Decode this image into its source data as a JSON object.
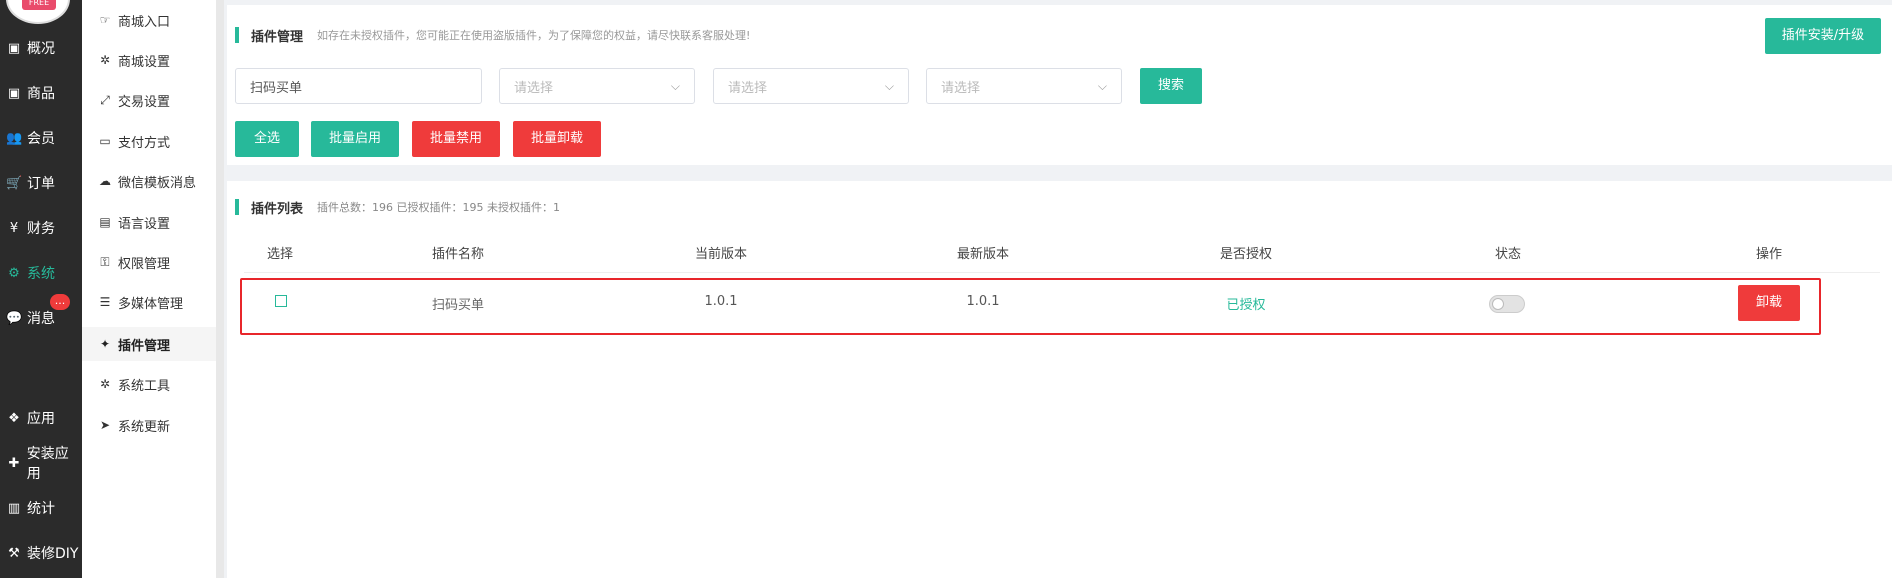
{
  "logo": {
    "badge_text": "FREE"
  },
  "main_nav": [
    {
      "label": "概况",
      "icon": "overview-icon",
      "glyph": "▣",
      "active": false
    },
    {
      "label": "商品",
      "icon": "goods-icon",
      "glyph": "▣",
      "active": false
    },
    {
      "label": "会员",
      "icon": "members-icon",
      "glyph": "👥",
      "active": false
    },
    {
      "label": "订单",
      "icon": "cart-icon",
      "glyph": "🛒",
      "active": false
    },
    {
      "label": "财务",
      "icon": "yen-icon",
      "glyph": "¥",
      "active": false
    },
    {
      "label": "系统",
      "icon": "gears-icon",
      "glyph": "⚙",
      "active": true
    },
    {
      "label": "消息",
      "icon": "chat-icon",
      "glyph": "💬",
      "active": false,
      "badge": "..."
    },
    {
      "label": "应用",
      "icon": "apps-icon",
      "glyph": "❖",
      "active": false
    },
    {
      "label": "安装应用",
      "icon": "puzzle-icon",
      "glyph": "✚",
      "active": false
    },
    {
      "label": "统计",
      "icon": "bar-chart-icon",
      "glyph": "▥",
      "active": false
    },
    {
      "label": "装修DIY",
      "icon": "gavel-icon",
      "glyph": "⚒",
      "active": false
    }
  ],
  "sub_nav": [
    {
      "label": "商城入口",
      "icon": "hand-point-icon",
      "glyph": "☞",
      "active": false
    },
    {
      "label": "商城设置",
      "icon": "gear-icon",
      "glyph": "✲",
      "active": false
    },
    {
      "label": "交易设置",
      "icon": "exchange-icon",
      "glyph": "⤢",
      "active": false
    },
    {
      "label": "支付方式",
      "icon": "credit-card-icon",
      "glyph": "▭",
      "active": false
    },
    {
      "label": "微信模板消息",
      "icon": "wechat-icon",
      "glyph": "☁",
      "active": false
    },
    {
      "label": "语言设置",
      "icon": "language-icon",
      "glyph": "▤",
      "active": false
    },
    {
      "label": "权限管理",
      "icon": "key-icon",
      "glyph": "⚿",
      "active": false
    },
    {
      "label": "多媒体管理",
      "icon": "list-icon",
      "glyph": "☰",
      "active": false
    },
    {
      "label": "插件管理",
      "icon": "plugin-icon",
      "glyph": "✦",
      "active": true
    },
    {
      "label": "系统工具",
      "icon": "cog-icon",
      "glyph": "✲",
      "active": false
    },
    {
      "label": "系统更新",
      "icon": "paper-plane-icon",
      "glyph": "➤",
      "active": false
    }
  ],
  "plugin_panel": {
    "title": "插件管理",
    "tip": "如存在未授权插件，您可能正在使用盗版插件，为了保障您的权益，请尽快联系客服处理!",
    "install_button": "插件安装/升级",
    "search_value": "扫码买单",
    "select_placeholders": [
      "请选择",
      "请选择",
      "请选择"
    ],
    "search_button": "搜索",
    "select_all": "全选",
    "batch_enable": "批量启用",
    "batch_disable": "批量禁用",
    "batch_uninstall": "批量卸载"
  },
  "plugin_list": {
    "title": "插件列表",
    "summary": "插件总数：196 已授权插件：195 未授权插件：1",
    "columns": [
      "选择",
      "插件名称",
      "当前版本",
      "最新版本",
      "是否授权",
      "状态",
      "操作"
    ],
    "rows": [
      {
        "name": "扫码买单",
        "current_version": "1.0.1",
        "latest_version": "1.0.1",
        "authorized": "已授权",
        "enabled": false,
        "action": "卸载"
      }
    ]
  },
  "colors": {
    "accent": "#27b99a",
    "danger": "#ef3b3b",
    "sidebar": "#2b2b2b"
  }
}
